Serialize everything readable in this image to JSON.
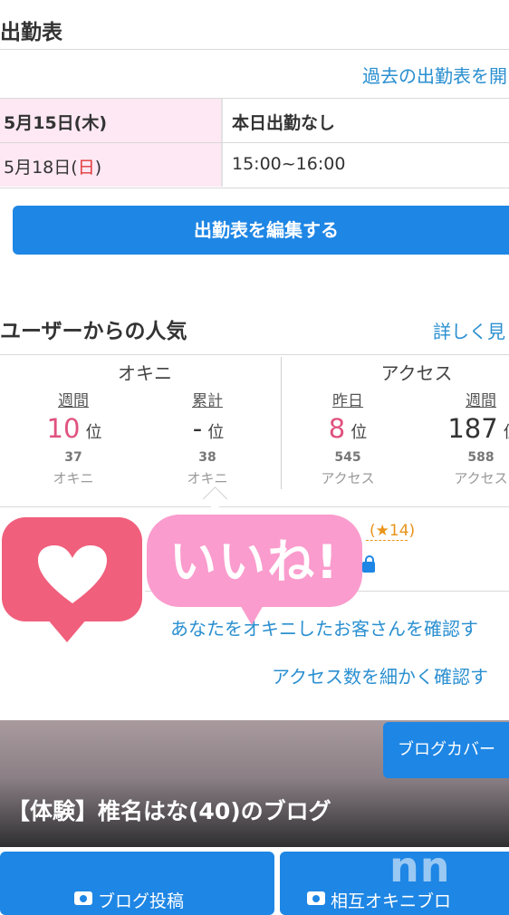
{
  "schedule": {
    "title": "出勤表",
    "past_link": "過去の出勤表を開",
    "rows": [
      {
        "date_prefix": "5月15日(",
        "day": "木",
        "date_suffix": ")",
        "value": "本日出勤なし"
      },
      {
        "date_prefix": "5月18日(",
        "day": "日",
        "date_suffix": ")",
        "value": "15:00~16:00"
      }
    ],
    "edit_button": "出勤表を編集する"
  },
  "popularity": {
    "title": "ユーザーからの人気",
    "more_link": "詳しく見",
    "okini": {
      "label": "オキニ",
      "weekly": {
        "label": "週間",
        "rank": "10",
        "unit": "位",
        "count": "37",
        "count_label": "オキニ"
      },
      "total": {
        "label": "累計",
        "rank": "-",
        "unit": "位",
        "count": "38",
        "count_label": "オキニ"
      }
    },
    "access": {
      "label": "アクセス",
      "yesterday": {
        "label": "昨日",
        "rank": "8",
        "unit": "位",
        "count": "545",
        "count_label": "アクセス"
      },
      "weekly": {
        "label": "週間",
        "rank": "187",
        "unit": "位",
        "count": "588",
        "count_label": "アクセス"
      }
    },
    "star_count": "(★14)",
    "link_okini_customers": "あなたをオキニしたお客さんを確認す",
    "link_access_detail": "アクセス数を細かく確認す"
  },
  "stickers": {
    "iine": "いいね!"
  },
  "blog": {
    "cover_button": "ブログカバー",
    "title": "【体験】椎名はな(40)のブログ",
    "post_button": "ブログ投稿",
    "mutual_button": "相互オキニブロ"
  },
  "watermark": "nn",
  "colors": {
    "accent_blue": "#1e86e4",
    "link_blue": "#2a8fd0",
    "rank_pink": "#e0527f",
    "sunday_red": "#e03a3a",
    "date_bg": "#fde8f3"
  }
}
